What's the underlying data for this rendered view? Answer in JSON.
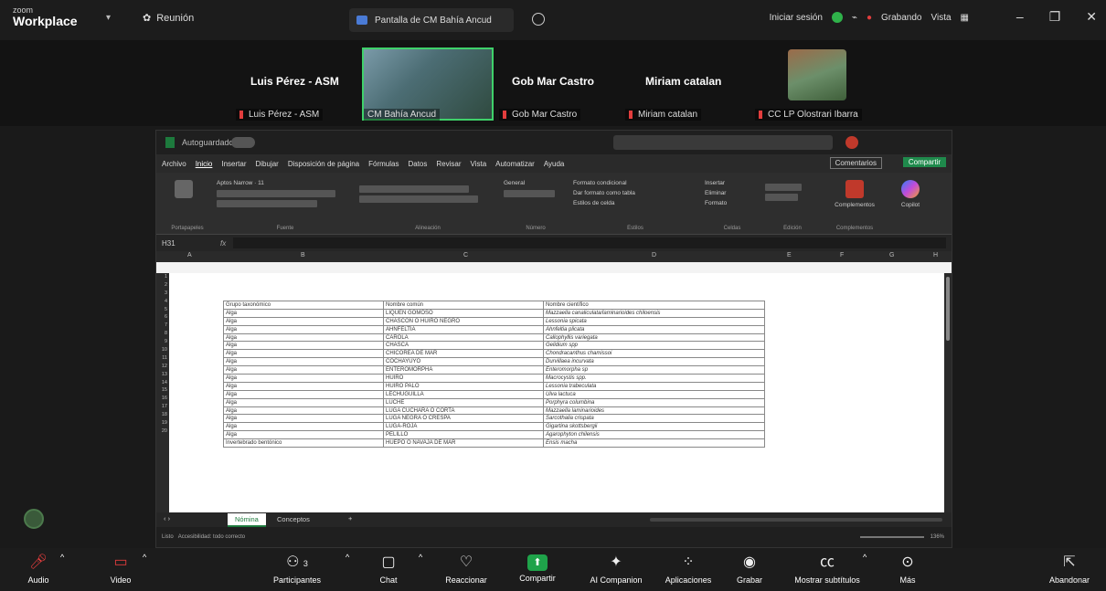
{
  "app": {
    "brand_top": "zoom",
    "brand_name": "Workplace",
    "meeting_label": "Reunión"
  },
  "top": {
    "share_title": "Pantalla de CM Bahía Ancud",
    "signin": "Iniciar sesión",
    "recording": "Grabando",
    "view": "Vista"
  },
  "participants": [
    {
      "big": "Luis Pérez - ASM",
      "label": "Luis Pérez - ASM"
    },
    {
      "label": "CM Bahía Ancud"
    },
    {
      "big": "Gob Mar Castro",
      "label": "Gob Mar Castro"
    },
    {
      "big": "Miriam catalan",
      "label": "Miriam catalan"
    },
    {
      "label": "CC LP Olostrari Ibarra"
    }
  ],
  "excel": {
    "autosave": "Autoguardado",
    "menu": [
      "Archivo",
      "Inicio",
      "Insertar",
      "Dibujar",
      "Disposición de página",
      "Fórmulas",
      "Datos",
      "Revisar",
      "Vista",
      "Automatizar",
      "Ayuda"
    ],
    "comments": "Comentarios",
    "share": "Compartir",
    "ribbon": {
      "clipboard": "Portapapeles",
      "font_name": "Aptos Narrow",
      "font_size": "11",
      "font": "Fuente",
      "alignment": "Alineación",
      "number_format": "General",
      "number": "Número",
      "cond_format": "Formato condicional",
      "table_format": "Dar formato como tabla",
      "cell_styles": "Estilos de celda",
      "styles": "Estilos",
      "insert": "Insertar",
      "delete": "Eliminar",
      "format": "Formato",
      "cells": "Celdas",
      "editing": "Edición",
      "addins_btn": "Complementos",
      "addins": "Complementos",
      "copilot": "Copilot"
    },
    "namebox": "H31",
    "columns": [
      "A",
      "B",
      "C",
      "D",
      "E",
      "F",
      "G",
      "H"
    ],
    "rows": [
      "1",
      "2",
      "3",
      "4",
      "5",
      "6",
      "7",
      "8",
      "9",
      "10",
      "11",
      "12",
      "13",
      "14",
      "15",
      "16",
      "17",
      "18",
      "19",
      "20"
    ],
    "headers": [
      "Grupo taxonómico",
      "Nombre común",
      "Nombre científico"
    ],
    "table": [
      [
        "Alga",
        "LIQUEN GOMOSO",
        "Mazzaella canaliculata/laminarioides chiloensis"
      ],
      [
        "Alga",
        "CHASCON O HUIRO NEGRO",
        "Lessonia spicata"
      ],
      [
        "Alga",
        "AHNFELTIA",
        "Ahnfeltia plicata"
      ],
      [
        "Alga",
        "CAROLA",
        "Callophyllis variegata"
      ],
      [
        "Alga",
        "CHASCA",
        "Gelidium spp"
      ],
      [
        "Alga",
        "CHICOREA DE MAR",
        "Chondracanthus chamissoi"
      ],
      [
        "Alga",
        "COCHAYUYO",
        "Durvillaea incurvata"
      ],
      [
        "Alga",
        "ENTEROMORPHA",
        "Enteromorpha sp"
      ],
      [
        "Alga",
        "HUIRO",
        "Macrocystis spp."
      ],
      [
        "Alga",
        "HUIRO PALO",
        "Lessonia trabeculata"
      ],
      [
        "Alga",
        "LECHUGUILLA",
        "Ulva lactuca"
      ],
      [
        "Alga",
        "LUCHE",
        "Porphyra columbina"
      ],
      [
        "Alga",
        "LUGA CUCHARA O CORTA",
        "Mazzaella laminarioides"
      ],
      [
        "Alga",
        "LUGA NEGRA O CRESPA",
        "Sarcothalia crispata"
      ],
      [
        "Alga",
        "LUGA-ROJA",
        "Gigartina skottsbergii"
      ],
      [
        "Alga",
        "PELILLO",
        "Agarophyton chilensis"
      ],
      [
        "Invertebrado bentónico",
        "HUEPO O NAVAJA DE MAR",
        "Ensis macha"
      ]
    ],
    "sheets": [
      "Nómina",
      "Conceptos"
    ],
    "status": "Listo",
    "accessibility": "Accesibilidad: todo correcto",
    "zoom": "136%"
  },
  "toolbar": {
    "audio": "Audio",
    "video": "Video",
    "participants": "Participantes",
    "participants_count": "3",
    "chat": "Chat",
    "reactions": "Reaccionar",
    "share": "Compartir",
    "ai": "AI Companion",
    "apps": "Aplicaciones",
    "record": "Grabar",
    "subtitles": "Mostrar subtítulos",
    "more": "Más",
    "leave": "Abandonar"
  }
}
